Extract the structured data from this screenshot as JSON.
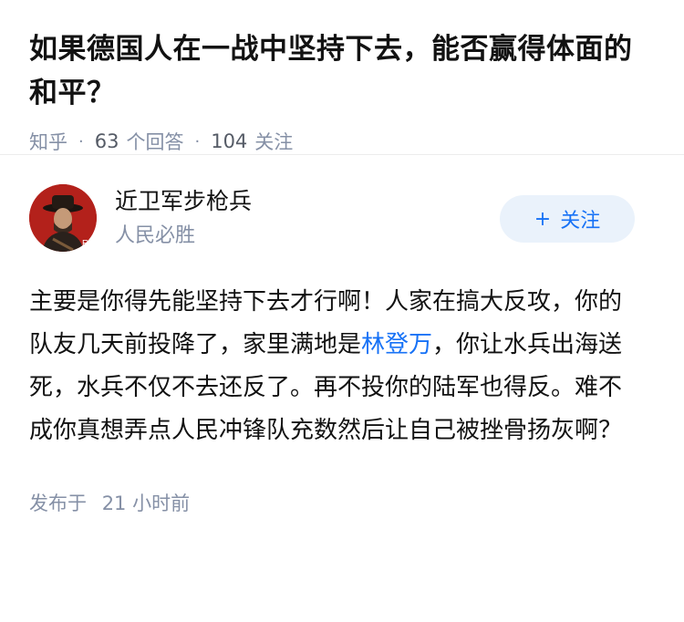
{
  "question": {
    "title": "如果德国人在一战中坚持下去，能否赢得体面的和平？",
    "source": "知乎",
    "answer_count": "63",
    "answer_label": "个回答",
    "follower_count": "104",
    "follower_label": "关注"
  },
  "answer": {
    "author_name": "近卫军步枪兵",
    "author_bio": "人民必胜",
    "follow_label": "关注",
    "follow_plus": "+",
    "content_part1": "主要是你得先能坚持下去才行啊！人家在搞大反攻，你的队友几天前投降了，家里满地是",
    "content_link": "林登万",
    "content_part2": "，你让水兵出海送死，水兵不仅不去还反了。再不投你的陆军也得反。难不成你真想弄点人民冲锋队充数然后让自己被挫骨扬灰啊？",
    "published_prefix": "发布于",
    "published_time": "21 小时前"
  },
  "colors": {
    "accent": "#1772f6",
    "meta_gray": "#8590a6",
    "follow_bg": "#eaf2fb"
  }
}
